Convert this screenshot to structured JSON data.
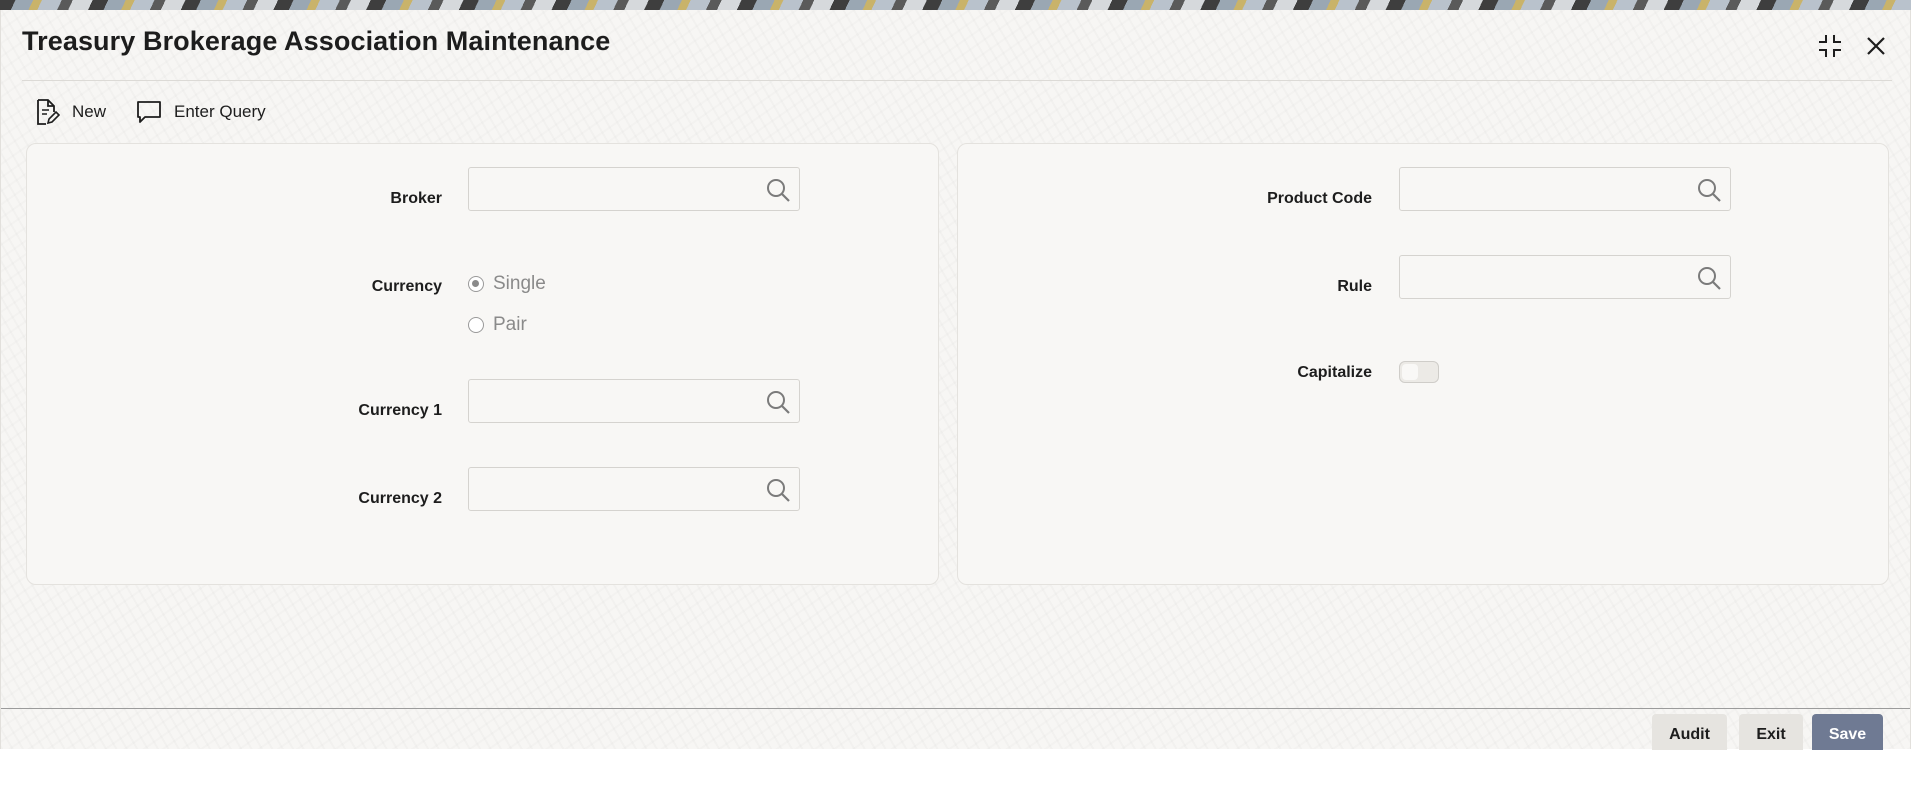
{
  "window": {
    "title": "Treasury Brokerage Association Maintenance"
  },
  "window_controls": {
    "minimize_icon": "collapse-icon",
    "close_icon": "close-icon"
  },
  "toolbar": {
    "new_label": "New",
    "new_icon": "new-document-icon",
    "enter_query_label": "Enter Query",
    "enter_query_icon": "chat-bubble-icon"
  },
  "left_panel": {
    "broker_label": "Broker",
    "broker_value": "",
    "currency_label": "Currency",
    "currency_options": [
      "Single",
      "Pair"
    ],
    "currency_selected": "Single",
    "currency1_label": "Currency 1",
    "currency1_value": "",
    "currency2_label": "Currency 2",
    "currency2_value": ""
  },
  "right_panel": {
    "product_code_label": "Product Code",
    "product_code_value": "",
    "rule_label": "Rule",
    "rule_value": "",
    "capitalize_label": "Capitalize",
    "capitalize_on": false
  },
  "footer": {
    "audit_label": "Audit",
    "exit_label": "Exit",
    "save_label": "Save"
  },
  "colors": {
    "primary_button": "#6f7a93",
    "secondary_button": "#e6e4e0",
    "panel_background": "#f8f7f5"
  }
}
